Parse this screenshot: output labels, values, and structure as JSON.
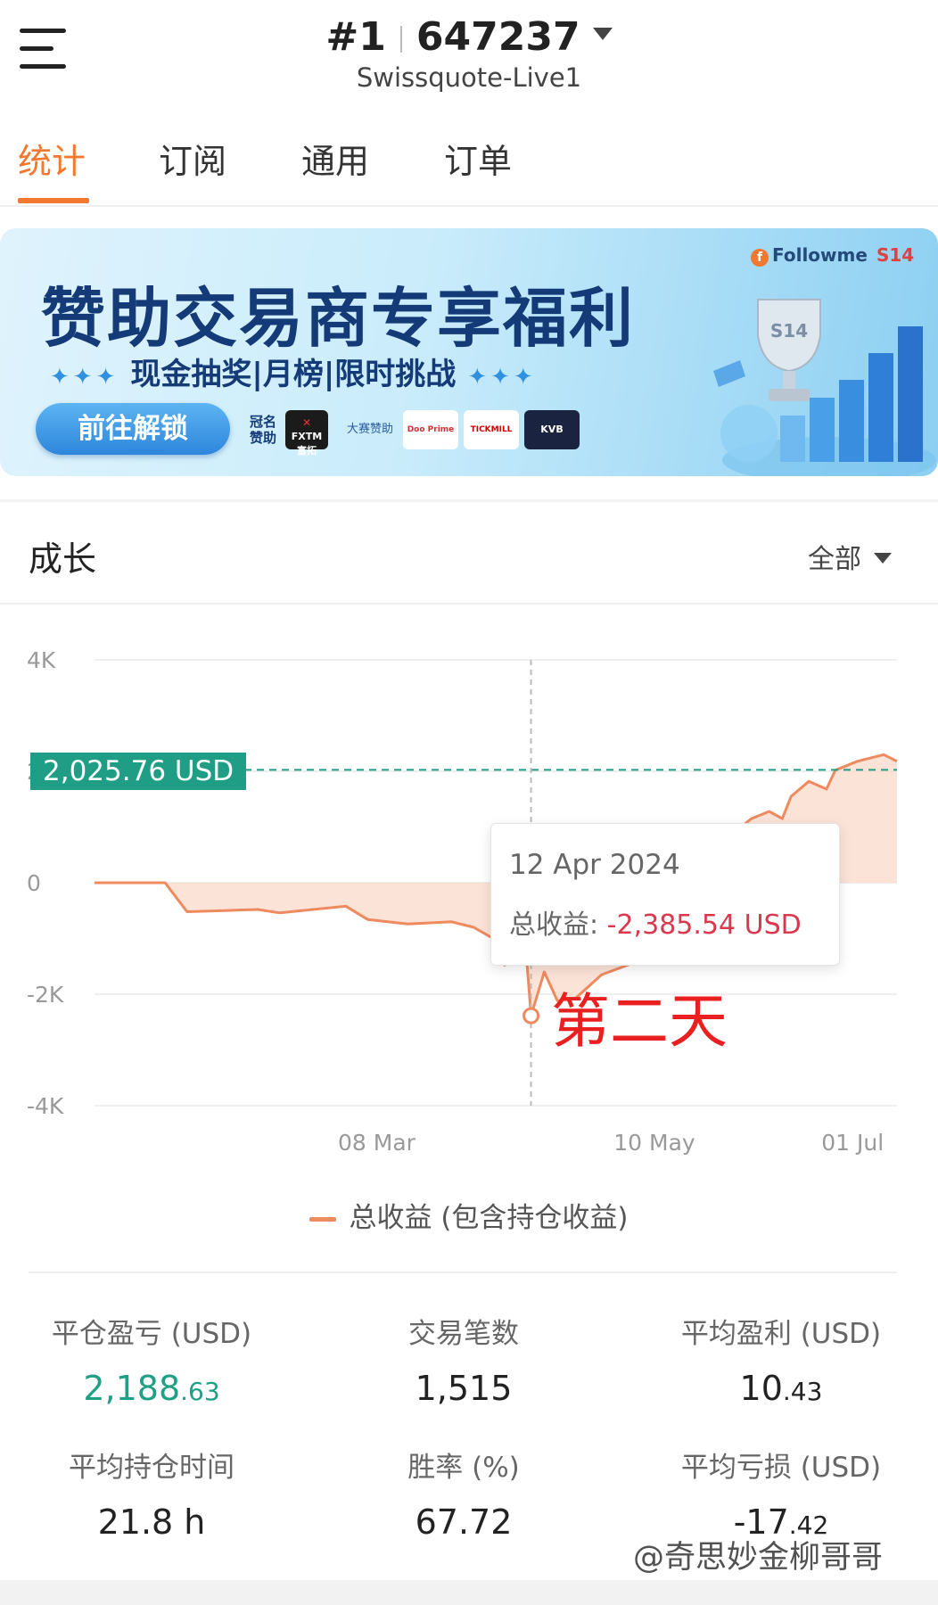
{
  "header": {
    "account_index": "#1",
    "account_number": "647237",
    "server": "Swissquote-Live1",
    "menu_icon": "hamburger-menu-icon"
  },
  "tabs": [
    {
      "label": "统计",
      "active": true
    },
    {
      "label": "订阅",
      "active": false
    },
    {
      "label": "通用",
      "active": false
    },
    {
      "label": "订单",
      "active": false
    }
  ],
  "banner": {
    "title": "赞助交易商专享福利",
    "subtitle": "现金抽奖|月榜|限时挑战",
    "button": "前往解锁",
    "sponsor_label_1": "冠名",
    "sponsor_label_2": "赞助",
    "sponsor_mid": "大赛赞助",
    "brand": "Followme",
    "brand_badge": "S14",
    "sponsors": [
      "FXTM",
      "Doo Prime",
      "TICKMILL",
      "KVB"
    ],
    "fxtm_sub": "富拓",
    "trophy_text": "S14"
  },
  "growth": {
    "title": "成长",
    "filter": "全部"
  },
  "chart_data": {
    "type": "area",
    "ylim": [
      -4000,
      4000
    ],
    "yticks": [
      "4K",
      "2K",
      "0",
      "-2K",
      "-4K"
    ],
    "xticks": [
      "08 Mar",
      "10 May",
      "01 Jul"
    ],
    "series": [
      {
        "name": "总收益 (包含持仓收益)",
        "color": "#ef8a5f",
        "points": [
          {
            "date": "2024-01-04",
            "y": 0
          },
          {
            "date": "2024-01-20",
            "y": 0
          },
          {
            "date": "2024-01-25",
            "y": -520
          },
          {
            "date": "2024-02-10",
            "y": -480
          },
          {
            "date": "2024-02-15",
            "y": -540
          },
          {
            "date": "2024-03-01",
            "y": -420
          },
          {
            "date": "2024-03-06",
            "y": -660
          },
          {
            "date": "2024-03-15",
            "y": -740
          },
          {
            "date": "2024-03-25",
            "y": -700
          },
          {
            "date": "2024-03-30",
            "y": -800
          },
          {
            "date": "2024-04-03",
            "y": -980
          },
          {
            "date": "2024-04-06",
            "y": -1480
          },
          {
            "date": "2024-04-10",
            "y": -1300
          },
          {
            "date": "2024-04-11",
            "y": -1360
          },
          {
            "date": "2024-04-12",
            "y": -2385.54
          },
          {
            "date": "2024-04-15",
            "y": -1600
          },
          {
            "date": "2024-04-18",
            "y": -2120
          },
          {
            "date": "2024-04-22",
            "y": -2080
          },
          {
            "date": "2024-04-28",
            "y": -1650
          },
          {
            "date": "2024-05-10",
            "y": -1300
          },
          {
            "date": "2024-05-20",
            "y": -500
          },
          {
            "date": "2024-05-28",
            "y": 900
          },
          {
            "date": "2024-06-01",
            "y": 1150
          },
          {
            "date": "2024-06-05",
            "y": 1280
          },
          {
            "date": "2024-06-08",
            "y": 1150
          },
          {
            "date": "2024-06-10",
            "y": 1550
          },
          {
            "date": "2024-06-14",
            "y": 1820
          },
          {
            "date": "2024-06-18",
            "y": 1680
          },
          {
            "date": "2024-06-20",
            "y": 2020
          },
          {
            "date": "2024-06-25",
            "y": 2180
          },
          {
            "date": "2024-07-01",
            "y": 2300
          },
          {
            "date": "2024-07-04",
            "y": 2180
          }
        ]
      }
    ],
    "current_value_label": "2,025.76 USD",
    "current_value": 2025.76,
    "tooltip": {
      "date": "12 Apr 2024",
      "label": "总收益:",
      "value": "-2,385.54 USD"
    },
    "annotation": "第二天",
    "legend": "总收益 (包含持仓收益)"
  },
  "stats": [
    {
      "label": "平仓盈亏 (USD)",
      "int": "2,188",
      "dec": ".63",
      "green": true
    },
    {
      "label": "交易笔数",
      "int": "1,515",
      "dec": "",
      "green": false
    },
    {
      "label": "平均盈利 (USD)",
      "int": "10",
      "dec": ".43",
      "green": false
    },
    {
      "label": "平均持仓时间",
      "int": "21.8 h",
      "dec": "",
      "green": false
    },
    {
      "label": "胜率 (%)",
      "int": "67.72",
      "dec": "",
      "green": false
    },
    {
      "label": "平均亏损 (USD)",
      "int": "-17",
      "dec": ".42",
      "green": false
    }
  ],
  "watermark": "@奇思妙金柳哥哥"
}
